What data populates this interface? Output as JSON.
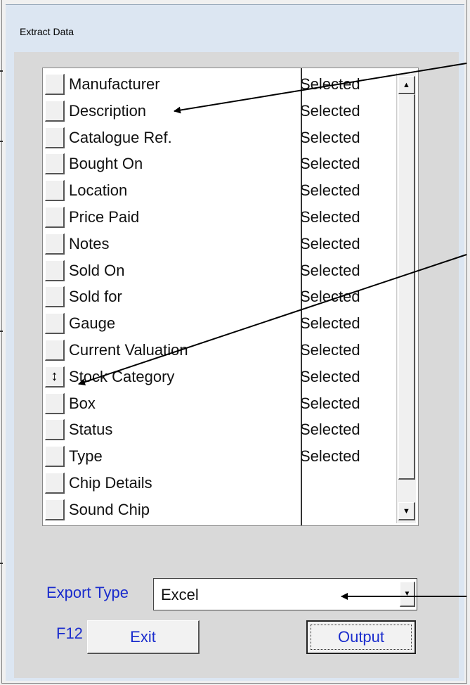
{
  "window": {
    "title": "Extract Data"
  },
  "fields": [
    {
      "label": "Manufacturer",
      "selected": "Selected"
    },
    {
      "label": "Description",
      "selected": "Selected"
    },
    {
      "label": "Catalogue Ref.",
      "selected": "Selected"
    },
    {
      "label": "Bought On",
      "selected": "Selected"
    },
    {
      "label": "Location",
      "selected": "Selected"
    },
    {
      "label": "Price Paid",
      "selected": "Selected"
    },
    {
      "label": "Notes",
      "selected": "Selected"
    },
    {
      "label": "Sold On",
      "selected": "Selected"
    },
    {
      "label": "Sold for",
      "selected": "Selected"
    },
    {
      "label": "Gauge",
      "selected": "Selected"
    },
    {
      "label": "Current Valuation",
      "selected": "Selected"
    },
    {
      "label": "Stock Category",
      "selected": "Selected",
      "icon": "resize-vertical-icon"
    },
    {
      "label": "Box",
      "selected": "Selected"
    },
    {
      "label": "Status",
      "selected": "Selected"
    },
    {
      "label": "Type",
      "selected": "Selected"
    },
    {
      "label": "Chip Details",
      "selected": ""
    },
    {
      "label": "Sound Chip",
      "selected": ""
    }
  ],
  "export": {
    "label": "Export Type",
    "value": "Excel"
  },
  "footer": {
    "f12_label": "F12",
    "exit_label": "Exit",
    "output_label": "Output"
  },
  "colors": {
    "label_blue": "#1a2ccd",
    "background": "#d9d9d9",
    "titlebar": "#dce6f2"
  }
}
